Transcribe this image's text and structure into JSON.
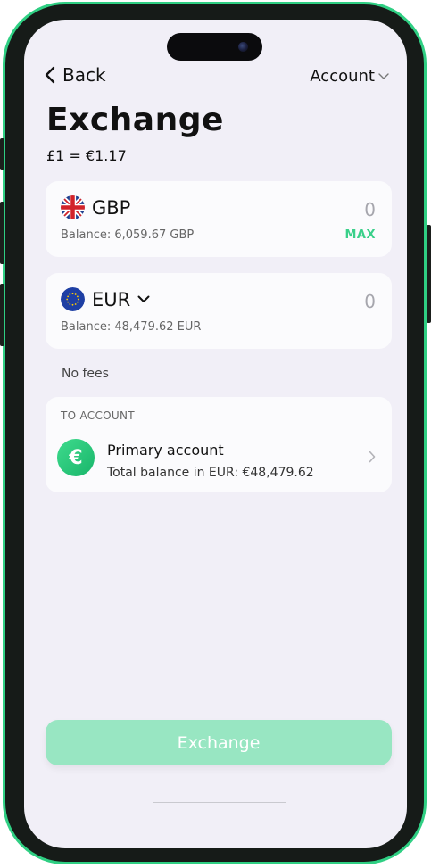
{
  "nav": {
    "back_label": "Back",
    "account_label": "Account"
  },
  "header": {
    "title": "Exchange",
    "rate": "£1 = €1.17"
  },
  "from_currency": {
    "code": "GBP",
    "flag": "uk-flag",
    "amount_placeholder": "0",
    "balance": "Balance: 6,059.67 GBP",
    "max_label": "MAX"
  },
  "to_currency": {
    "code": "EUR",
    "flag": "eu-flag",
    "amount_placeholder": "0",
    "balance": "Balance: 48,479.62 EUR"
  },
  "fees_note": "No fees",
  "to_account": {
    "section_label": "TO ACCOUNT",
    "icon_symbol": "€",
    "name": "Primary account",
    "balance": "Total balance in EUR: €48,479.62"
  },
  "exchange_button_label": "Exchange",
  "colors": {
    "accent": "#3ad08a",
    "button_disabled": "#98e6c2",
    "screen_bg": "#f1eff7",
    "frame_border": "#2fcf83"
  }
}
